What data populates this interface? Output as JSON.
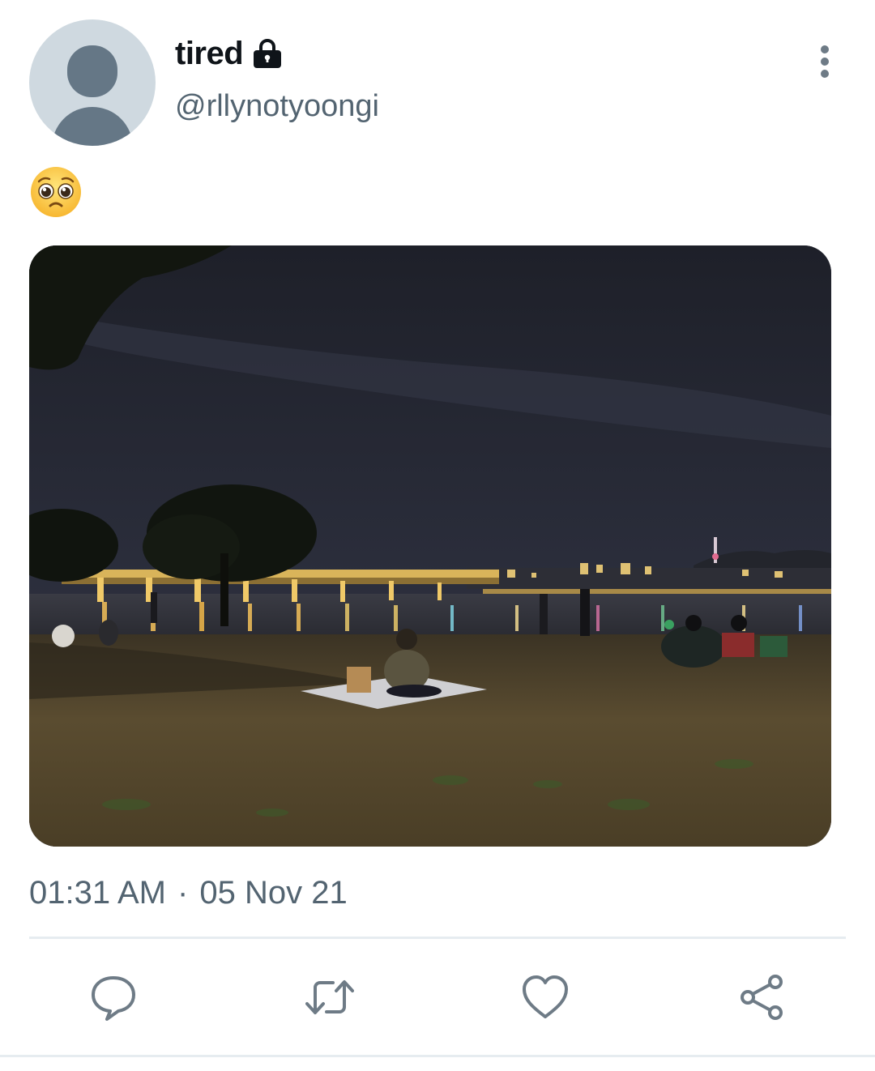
{
  "user": {
    "display_name": "tired",
    "handle": "@rllynotyoongi",
    "protected_icon": "lock-icon",
    "avatar": "default-avatar"
  },
  "tweet": {
    "text_emoji": "pleading-face-emoji",
    "media": "night-photo-river-park-bridge",
    "time": "01:31 AM",
    "separator": "·",
    "date": "05 Nov 21"
  },
  "actions": [
    {
      "name": "reply",
      "icon": "comment-icon"
    },
    {
      "name": "retweet",
      "icon": "retweet-icon"
    },
    {
      "name": "like",
      "icon": "heart-icon"
    },
    {
      "name": "share",
      "icon": "share-icon"
    }
  ],
  "colors": {
    "primary_text": "#0f1419",
    "secondary_text": "#536471",
    "icon": "#6e7b86",
    "divider": "#e6ecf0"
  }
}
